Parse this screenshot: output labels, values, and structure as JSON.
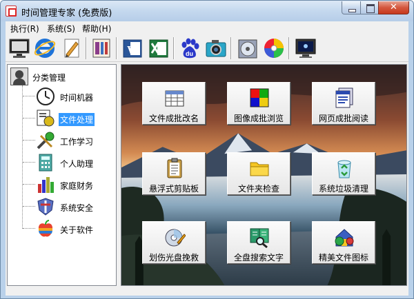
{
  "window": {
    "title": "时间管理专家   (免费版)"
  },
  "menu": [
    {
      "label": "执行(R)"
    },
    {
      "label": "系统(S)"
    },
    {
      "label": "帮助(H)"
    }
  ],
  "toolbar": [
    {
      "icon": "monitor-icon"
    },
    {
      "icon": "ie-browser-icon"
    },
    {
      "icon": "pen-notepad-icon"
    },
    {
      "icon": "spreadsheet-doc-icon"
    },
    {
      "icon": "word-icon"
    },
    {
      "icon": "excel-icon"
    },
    {
      "icon": "baidu-icon"
    },
    {
      "icon": "camera-icon"
    },
    {
      "icon": "disc-drive-icon"
    },
    {
      "icon": "cd-icon"
    },
    {
      "icon": "screen-icon"
    }
  ],
  "tree": {
    "root": {
      "label": "分类管理",
      "icon": "user-avatar-icon"
    },
    "items": [
      {
        "label": "时间机器",
        "icon": "clock-icon"
      },
      {
        "label": "文件处理",
        "icon": "file-tools-icon",
        "selected": true
      },
      {
        "label": "工作学习",
        "icon": "tools-icon"
      },
      {
        "label": "个人助理",
        "icon": "calculator-icon"
      },
      {
        "label": "家庭财务",
        "icon": "bar-chart-icon"
      },
      {
        "label": "系统安全",
        "icon": "shield-icon"
      },
      {
        "label": "关于软件",
        "icon": "apple-icon"
      }
    ]
  },
  "functions": [
    {
      "label": "文件成批改名",
      "icon": "batch-rename-icon"
    },
    {
      "label": "图像成批浏览",
      "icon": "image-browse-icon"
    },
    {
      "label": "网页成批阅读",
      "icon": "webpage-read-icon"
    },
    {
      "label": "悬浮式剪贴板",
      "icon": "clipboard-icon"
    },
    {
      "label": "文件夹检查",
      "icon": "folder-icon"
    },
    {
      "label": "系统垃圾清理",
      "icon": "recycle-bin-icon"
    },
    {
      "label": "划伤光盘挽救",
      "icon": "disc-repair-icon"
    },
    {
      "label": "全盘搜索文字",
      "icon": "search-book-icon"
    },
    {
      "label": "精美文件图标",
      "icon": "file-icon-set-icon"
    }
  ],
  "colors": {
    "selection": "#3399ff",
    "titlebar": "#c4d8ee",
    "close": "#c7391d"
  }
}
